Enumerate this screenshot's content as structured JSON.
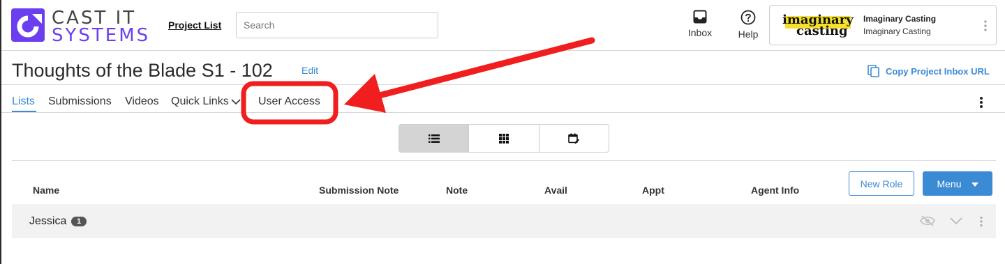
{
  "brand": {
    "line1": "CAST IT",
    "line2": "SYSTEMS",
    "accent": "#6b3ff0"
  },
  "header": {
    "project_list_link": "Project List",
    "search_placeholder": "Search",
    "inbox_label": "Inbox",
    "help_label": "Help",
    "account": {
      "logo_word1": "imaginary",
      "logo_word2": "casting",
      "name": "Imaginary Casting",
      "company": "Imaginary Casting"
    }
  },
  "project": {
    "title": "Thoughts of the Blade S1 - 102",
    "edit_label": "Edit",
    "copy_inbox_url_label": "Copy Project Inbox URL"
  },
  "tabs": [
    {
      "label": "Lists",
      "active": true
    },
    {
      "label": "Submissions",
      "active": false
    },
    {
      "label": "Videos",
      "active": false
    },
    {
      "label": "Quick Links",
      "active": false
    },
    {
      "label": "User Access",
      "active": false
    }
  ],
  "view_toggle": [
    {
      "icon": "list-view-icon",
      "active": true
    },
    {
      "icon": "grid-view-icon",
      "active": false
    },
    {
      "icon": "calendar-edit-icon",
      "active": false
    }
  ],
  "table": {
    "columns": [
      "Name",
      "Submission Note",
      "Note",
      "Avail",
      "Appt",
      "Agent Info"
    ],
    "new_role_label": "New Role",
    "menu_label": "Menu",
    "roles": [
      {
        "name": "Jessica",
        "count": "1"
      }
    ]
  },
  "colors": {
    "link_blue": "#3b8ad4",
    "annotation_red": "#f01e1e"
  }
}
